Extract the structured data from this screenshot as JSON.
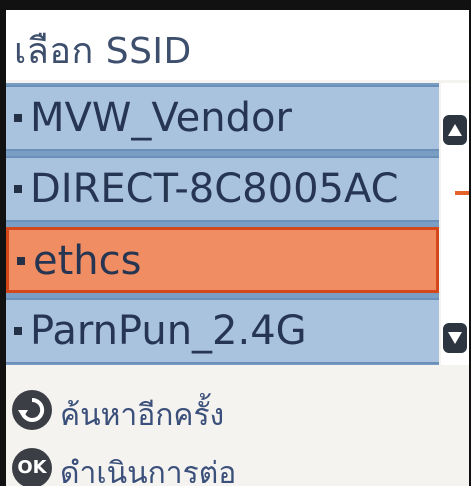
{
  "header": {
    "title": "เลือก SSID"
  },
  "ssid_list": {
    "items": [
      {
        "label": "MVW_Vendor",
        "selected": false
      },
      {
        "label": "DIRECT-8C8005AC",
        "selected": false
      },
      {
        "label": "ethcs",
        "selected": true
      },
      {
        "label": "ParnPun_2.4G",
        "selected": false
      }
    ]
  },
  "footer": {
    "search_again_label": "ค้นหาอีกครั้ง",
    "ok_icon_text": "OK",
    "continue_label": "ดำเนินการต่อ"
  },
  "colors": {
    "row": "#a9c3df",
    "selected_row": "#f08d62",
    "selected_border": "#d4471a"
  }
}
